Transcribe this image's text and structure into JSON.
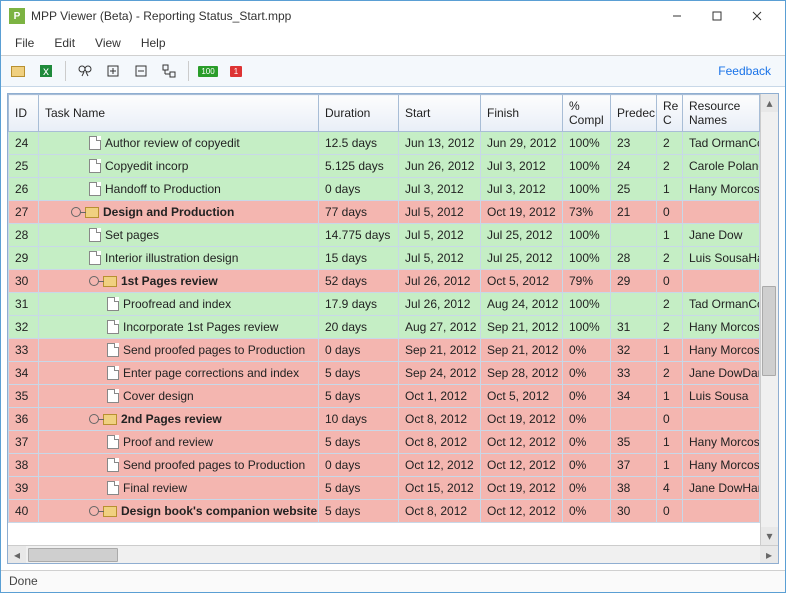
{
  "window": {
    "app_letter": "P",
    "title": "MPP Viewer (Beta) - Reporting Status_Start.mpp"
  },
  "menu": {
    "file": "File",
    "edit": "Edit",
    "view": "View",
    "help": "Help"
  },
  "toolbar": {
    "feedback": "Feedback",
    "badge100": "100",
    "badge1": "1"
  },
  "columns": {
    "id": "ID",
    "task": "Task Name",
    "duration": "Duration",
    "start": "Start",
    "finish": "Finish",
    "complete": "% Compl",
    "pred": "Predec",
    "rc": "Re C",
    "resources": "Resource Names"
  },
  "rows": [
    {
      "id": "24",
      "indent": 2,
      "icon": "page",
      "name": "Author review of copyedit",
      "duration": "12.5 days",
      "start": "Jun 13, 2012",
      "finish": "Jun 29, 2012",
      "complete": "100%",
      "pred": "23",
      "rc": "2",
      "res": "Tad OrmanCopye",
      "cls": "row-green"
    },
    {
      "id": "25",
      "indent": 2,
      "icon": "page",
      "name": "Copyedit incorp",
      "duration": "5.125 days",
      "start": "Jun 26, 2012",
      "finish": "Jul 3, 2012",
      "complete": "100%",
      "pred": "24",
      "rc": "2",
      "res": "Carole PolandDa",
      "cls": "row-green"
    },
    {
      "id": "26",
      "indent": 2,
      "icon": "page",
      "name": "Handoff to Production",
      "duration": "0 days",
      "start": "Jul 3, 2012",
      "finish": "Jul 3, 2012",
      "complete": "100%",
      "pred": "25",
      "rc": "1",
      "res": "Hany Morcos",
      "cls": "row-green"
    },
    {
      "id": "27",
      "indent": 1,
      "icon": "folder",
      "key": true,
      "bold": true,
      "name": "Design and Production",
      "duration": "77 days",
      "start": "Jul 5, 2012",
      "finish": "Oct 19, 2012",
      "complete": "73%",
      "pred": "21",
      "rc": "0",
      "res": "",
      "cls": "row-pink"
    },
    {
      "id": "28",
      "indent": 2,
      "icon": "page",
      "name": "Set pages",
      "duration": "14.775 days",
      "start": "Jul 5, 2012",
      "finish": "Jul 25, 2012",
      "complete": "100%",
      "pred": "",
      "rc": "1",
      "res": "Jane Dow",
      "cls": "row-green"
    },
    {
      "id": "29",
      "indent": 2,
      "icon": "page",
      "name": "Interior illustration design",
      "duration": "15 days",
      "start": "Jul 5, 2012",
      "finish": "Jul 25, 2012",
      "complete": "100%",
      "pred": "28",
      "rc": "2",
      "res": "Luis SousaHany M",
      "cls": "row-green"
    },
    {
      "id": "30",
      "indent": 2,
      "icon": "folder",
      "key": true,
      "bold": true,
      "name": "1st Pages review",
      "duration": "52 days",
      "start": "Jul 26, 2012",
      "finish": "Oct 5, 2012",
      "complete": "79%",
      "pred": "29",
      "rc": "0",
      "res": "",
      "cls": "row-pink"
    },
    {
      "id": "31",
      "indent": 3,
      "icon": "page",
      "name": "Proofread and index",
      "duration": "17.9 days",
      "start": "Jul 26, 2012",
      "finish": "Aug 24, 2012",
      "complete": "100%",
      "pred": "",
      "rc": "2",
      "res": "Tad OrmanCopye",
      "cls": "row-green"
    },
    {
      "id": "32",
      "indent": 3,
      "icon": "page",
      "name": "Incorporate 1st Pages review",
      "duration": "20 days",
      "start": "Aug 27, 2012",
      "finish": "Sep 21, 2012",
      "complete": "100%",
      "pred": "31",
      "rc": "2",
      "res": "Hany MorcosDan",
      "cls": "row-green"
    },
    {
      "id": "33",
      "indent": 3,
      "icon": "page",
      "name": "Send proofed pages to Production",
      "duration": "0 days",
      "start": "Sep 21, 2012",
      "finish": "Sep 21, 2012",
      "complete": "0%",
      "pred": "32",
      "rc": "1",
      "res": "Hany Morcos",
      "cls": "row-pink"
    },
    {
      "id": "34",
      "indent": 3,
      "icon": "page",
      "name": "Enter page corrections and index",
      "duration": "5 days",
      "start": "Sep 24, 2012",
      "finish": "Sep 28, 2012",
      "complete": "0%",
      "pred": "33",
      "rc": "2",
      "res": "Jane DowDan Jun",
      "cls": "row-pink"
    },
    {
      "id": "35",
      "indent": 3,
      "icon": "page",
      "name": "Cover design",
      "duration": "5 days",
      "start": "Oct 1, 2012",
      "finish": "Oct 5, 2012",
      "complete": "0%",
      "pred": "34",
      "rc": "1",
      "res": "Luis Sousa",
      "cls": "row-pink"
    },
    {
      "id": "36",
      "indent": 2,
      "icon": "folder",
      "key": true,
      "bold": true,
      "name": "2nd Pages review",
      "duration": "10 days",
      "start": "Oct 8, 2012",
      "finish": "Oct 19, 2012",
      "complete": "0%",
      "pred": "",
      "rc": "0",
      "res": "",
      "cls": "row-pink"
    },
    {
      "id": "37",
      "indent": 3,
      "icon": "page",
      "name": "Proof and review",
      "duration": "5 days",
      "start": "Oct 8, 2012",
      "finish": "Oct 12, 2012",
      "complete": "0%",
      "pred": "35",
      "rc": "1",
      "res": "Hany Morcos",
      "cls": "row-pink"
    },
    {
      "id": "38",
      "indent": 3,
      "icon": "page",
      "name": "Send proofed pages to Production",
      "duration": "0 days",
      "start": "Oct 12, 2012",
      "finish": "Oct 12, 2012",
      "complete": "0%",
      "pred": "37",
      "rc": "1",
      "res": "Hany Morcos",
      "cls": "row-pink"
    },
    {
      "id": "39",
      "indent": 3,
      "icon": "page",
      "name": "Final review",
      "duration": "5 days",
      "start": "Oct 15, 2012",
      "finish": "Oct 19, 2012",
      "complete": "0%",
      "pred": "38",
      "rc": "4",
      "res": "Jane DowHany Mo",
      "cls": "row-pink"
    },
    {
      "id": "40",
      "indent": 2,
      "icon": "folder",
      "key": true,
      "bold": true,
      "name": "Design book's companion website",
      "duration": "5 days",
      "start": "Oct 8, 2012",
      "finish": "Oct 12, 2012",
      "complete": "0%",
      "pred": "30",
      "rc": "0",
      "res": "",
      "cls": "row-pink"
    }
  ],
  "status": "Done"
}
